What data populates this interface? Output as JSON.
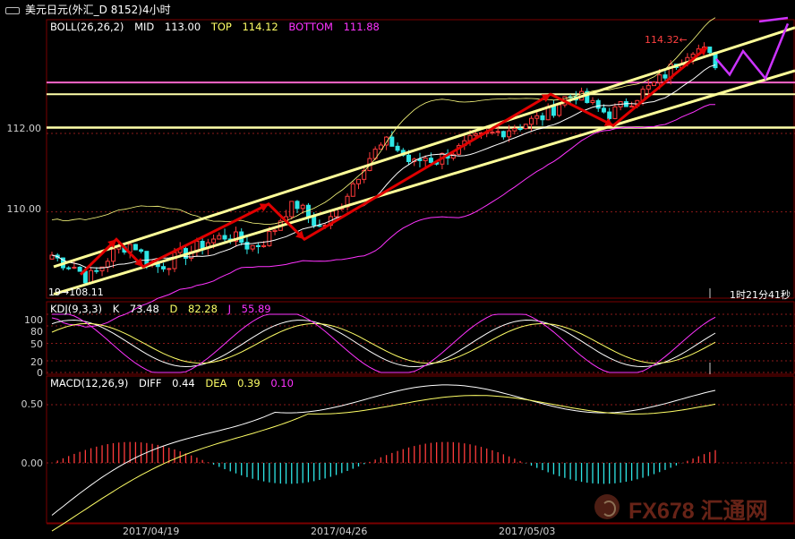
{
  "window": {
    "title": "美元日元(外汇_D 8152)4小时"
  },
  "boll": {
    "label": "BOLL(26,26,2)",
    "mid_label": "MID",
    "mid_value": "113.00",
    "top_label": "TOP",
    "top_value": "114.12",
    "bottom_label": "BOTTOM",
    "bottom_value": "111.88"
  },
  "kdj": {
    "label": "KDJ(9,3,3)",
    "k_label": "K",
    "k_value": "73.48",
    "d_label": "D",
    "d_value": "82.28",
    "j_label": "J",
    "j_value": "55.89"
  },
  "macd": {
    "label": "MACD(12,26,9)",
    "diff_label": "DIFF",
    "diff_value": "0.44",
    "dea_label": "DEA",
    "dea_value": "0.39",
    "macd_value": "0.10"
  },
  "annotations": {
    "high_label": "114.32",
    "low_label": "108.11",
    "low_prefix": "19",
    "countdown": "1时21分41秒"
  },
  "watermark": "FX678 汇通网",
  "colors": {
    "up": "#ff3b3b",
    "down": "#2ee6e6",
    "mid": "#ffffff",
    "boll_top": "#ffff66",
    "boll_bottom": "#ff33ff",
    "trendline": "#ffff99",
    "level_line": "#ff66cc",
    "arrow_red": "#e00000",
    "arrow_magenta": "#cc33ff"
  },
  "chart_data": [
    {
      "type": "candlestick",
      "name": "price",
      "y_ticks": [
        "112.00",
        "110.00"
      ],
      "ylim": [
        107.8,
        114.9
      ],
      "x_ticks": [
        "2017/04/19",
        "2017/04/26",
        "2017/05/03"
      ],
      "horizontal_levels": [
        113.3,
        113.0,
        112.15
      ],
      "high": 114.32,
      "low": 108.11,
      "close_path": [
        108.9,
        108.7,
        108.6,
        108.3,
        108.5,
        108.9,
        109.1,
        109.2,
        108.8,
        108.6,
        108.7,
        108.9,
        109.0,
        109.2,
        109.3,
        109.4,
        109.3,
        109.1,
        109.2,
        109.5,
        110.0,
        110.2,
        109.9,
        109.6,
        109.8,
        110.3,
        110.8,
        111.3,
        111.6,
        111.8,
        111.5,
        111.2,
        111.4,
        111.3,
        111.5,
        111.6,
        111.8,
        111.9,
        112.0,
        112.1,
        112.2,
        112.3,
        112.4,
        112.6,
        112.9,
        113.0,
        112.8,
        112.6,
        112.5,
        112.7,
        112.9,
        113.1,
        113.3,
        113.6,
        113.9,
        114.2,
        114.1,
        113.8
      ]
    },
    {
      "type": "line",
      "name": "KDJ",
      "y_ticks": [
        "100",
        "80",
        "50",
        "20",
        "0"
      ],
      "ylim": [
        0,
        100
      ],
      "last": {
        "K": 73.48,
        "D": 82.28,
        "J": 55.89
      }
    },
    {
      "type": "bar",
      "name": "MACD",
      "y_ticks": [
        "0.50",
        "0.00"
      ],
      "last": {
        "DIFF": 0.44,
        "DEA": 0.39,
        "MACD": 0.1
      }
    }
  ]
}
